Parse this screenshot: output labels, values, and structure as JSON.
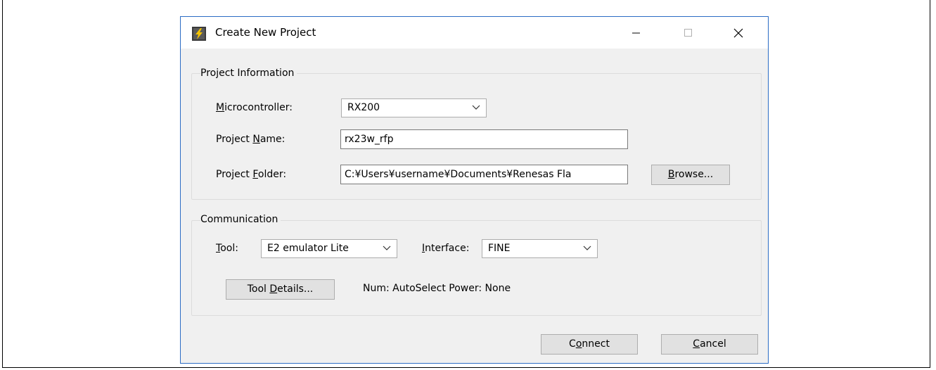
{
  "window": {
    "title": "Create New Project",
    "controls": {
      "minimize": "minimize",
      "maximize": "maximize",
      "close": "close"
    }
  },
  "project_information": {
    "group_title": "Project Information",
    "microcontroller": {
      "label_mnemonic": "M",
      "label_rest": "icrocontroller:",
      "value": "RX200"
    },
    "project_name": {
      "label_pre": "Project ",
      "label_mnemonic": "N",
      "label_post": "ame:",
      "value": "rx23w_rfp"
    },
    "project_folder": {
      "label_pre": "Project ",
      "label_mnemonic": "F",
      "label_post": "older:",
      "value": "C:¥Users¥username¥Documents¥Renesas Fla"
    },
    "browse_button": {
      "mnemonic": "B",
      "rest": "rowse..."
    }
  },
  "communication": {
    "group_title": "Communication",
    "tool": {
      "label_mnemonic": "T",
      "label_rest": "ool:",
      "value": "E2 emulator Lite"
    },
    "interface": {
      "label_mnemonic": "I",
      "label_rest": "nterface:",
      "value": "FINE"
    },
    "tool_details_button": {
      "pre": "Tool ",
      "mnemonic": "D",
      "post": "etails..."
    },
    "status_text": "Num: AutoSelect  Power: None"
  },
  "footer": {
    "connect_button": {
      "pre": "C",
      "mnemonic": "o",
      "post": "nnect"
    },
    "cancel_button": {
      "mnemonic": "C",
      "rest": "ancel"
    }
  },
  "colors": {
    "dialog_bg": "#f0f0f0",
    "window_border": "#2b6cc4",
    "button_bg": "#e1e1e1"
  },
  "icons": [
    "app-icon",
    "minimize-icon",
    "maximize-icon",
    "close-icon",
    "chevron-down-icon"
  ]
}
